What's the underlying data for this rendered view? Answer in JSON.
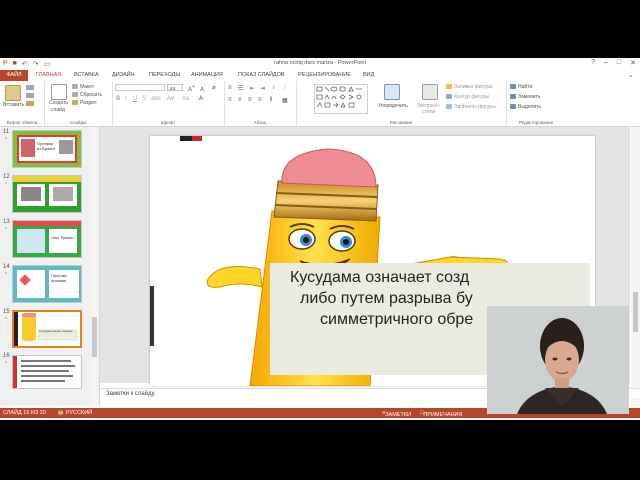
{
  "titlebar": {
    "title": "rahna ochiq dars manza - PowerPoint",
    "quick_access": [
      "save-icon",
      "undo-icon",
      "redo-icon",
      "present-icon"
    ]
  },
  "tabs": {
    "file": "ФАЙЛ",
    "items": [
      "ГЛАВНАЯ",
      "ВСТАВКА",
      "ДИЗАЙН",
      "ПЕРЕХОДЫ",
      "АНИМАЦИЯ",
      "ПОКАЗ СЛАЙДОВ",
      "РЕЦЕНЗИРОВАНИЕ",
      "ВИД"
    ]
  },
  "ribbon": {
    "clipboard": {
      "label": "Буфер обмена",
      "paste": "Вставить"
    },
    "slides": {
      "label": "Слайды",
      "new_slide_1": "Создать",
      "new_slide_2": "слайд",
      "layout": "Макет",
      "reset": "Сбросить",
      "section": "Раздел"
    },
    "font": {
      "label": "Шрифт",
      "font_size": "24"
    },
    "paragraph": {
      "label": "Абзац"
    },
    "drawing": {
      "label": "Рисование",
      "arrange": "Упорядочить",
      "quick_styles_1": "Экспресс-",
      "quick_styles_2": "стили",
      "fill": "Заливка фигуры",
      "outline": "Контур фигуры",
      "effects": "Эффекты фигуры"
    },
    "editing": {
      "label": "Редактирование",
      "find": "Найти",
      "replace": "Заменить",
      "select": "Выделить"
    }
  },
  "thumbnails": [
    {
      "num": "11",
      "star": "*",
      "text": "Оригами из бумаги"
    },
    {
      "num": "12",
      "star": "*",
      "text": ""
    },
    {
      "num": "13",
      "star": "*",
      "text": "Лист бумаги"
    },
    {
      "num": "14",
      "star": "*",
      "text": "Простая оригами"
    },
    {
      "num": "15",
      "star": "*",
      "text": "Кусудама означает создание..."
    },
    {
      "num": "16",
      "star": "*",
      "text": ""
    }
  ],
  "slide": {
    "line1": "Кусудама означает созд",
    "line2": "либо путем разрыва бу",
    "line3": "симметричного обре"
  },
  "notes": {
    "placeholder": "Заметки к слайду"
  },
  "status": {
    "slide_pos": "СЛАЙД 15 ИЗ 20",
    "language": "РУССКИЙ",
    "notes": "ЗАМЕТКИ",
    "comments": "ПРИМЕЧАНИЯ"
  },
  "colors": {
    "accent": "#b7472a",
    "selection": "#e67e22"
  }
}
